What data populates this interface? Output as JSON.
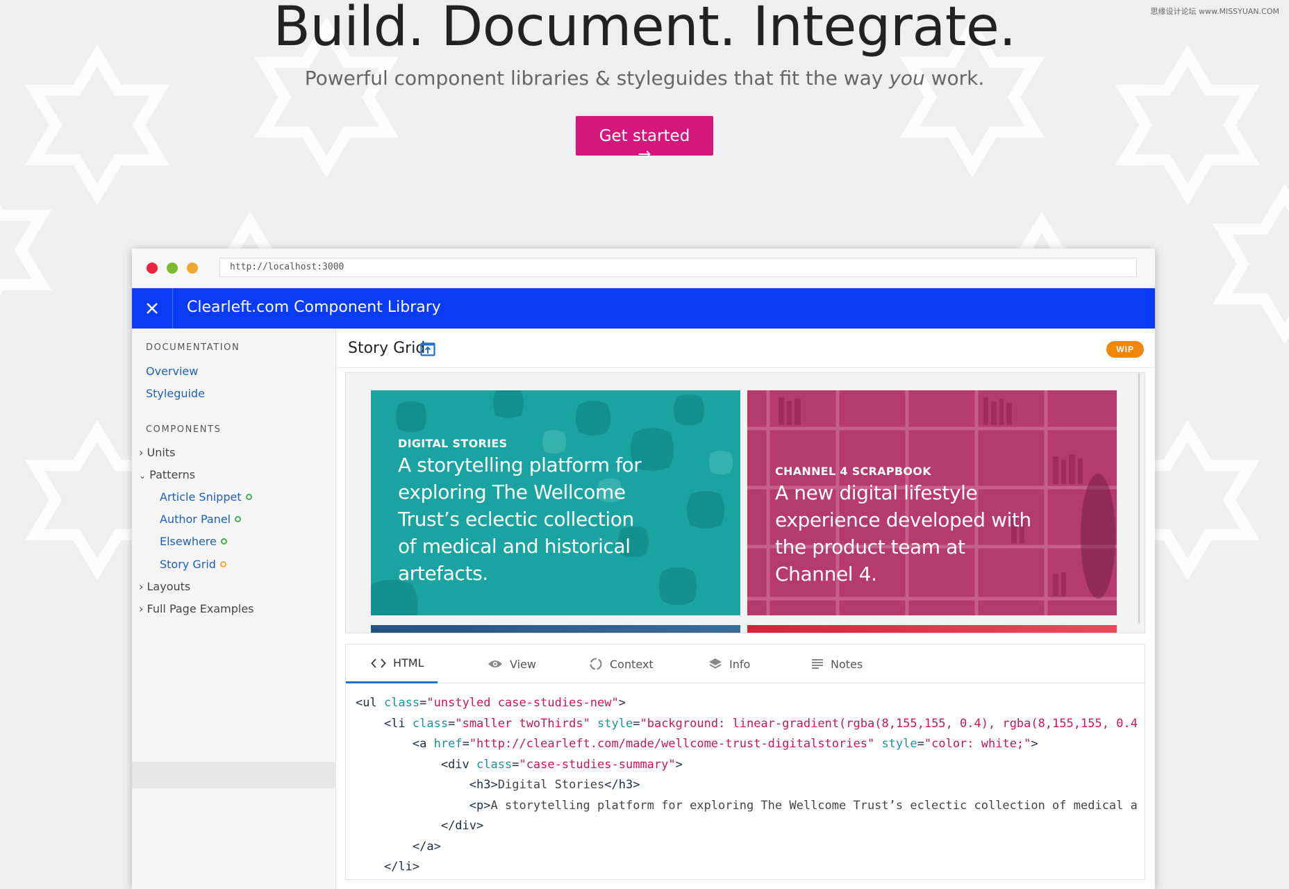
{
  "hero": {
    "title": "Build. Document. Integrate.",
    "subtitle_before": "Powerful component libraries & styleguides that fit the way ",
    "subtitle_em": "you",
    "subtitle_after": " work.",
    "cta_label": "Get started →"
  },
  "watermark": "思缘设计论坛 www.MISSYUAN.COM",
  "browser": {
    "url": "http://localhost:3000"
  },
  "app": {
    "title": "Clearleft.com Component Library"
  },
  "sidebar": {
    "documentation_heading": "DOCUMENTATION",
    "doc_links": [
      "Overview",
      "Styleguide"
    ],
    "components_heading": "COMPONENTS",
    "items": [
      {
        "label": "Units",
        "expanded": false
      },
      {
        "label": "Patterns",
        "expanded": true
      },
      {
        "label": "Layouts",
        "expanded": false
      },
      {
        "label": "Full Page Examples",
        "expanded": false
      }
    ],
    "pattern_children": [
      {
        "label": "Article Snippet",
        "status_color": "#3cb34a"
      },
      {
        "label": "Author Panel",
        "status_color": "#3cb34a"
      },
      {
        "label": "Elsewhere",
        "status_color": "#3cb34a"
      },
      {
        "label": "Story Grid",
        "status_color": "#f0a634",
        "active": true
      }
    ]
  },
  "component": {
    "name": "Story Grid",
    "status_badge": "WIP",
    "status_color": "#f0860a"
  },
  "preview": {
    "cards": [
      {
        "label": "DIGITAL STORIES",
        "body": "A storytelling platform for exploring The Wellcome Trust’s eclectic collection of medical and historical artefacts.",
        "color": "#1aa3a0"
      },
      {
        "label": "CHANNEL 4 SCRAPBOOK",
        "body": "A new digital lifestyle experience developed with the product team at Channel 4.",
        "color": "#b53a6e"
      }
    ]
  },
  "tabs": [
    {
      "label": "HTML",
      "icon": "code-icon",
      "active": true
    },
    {
      "label": "View",
      "icon": "eye-icon",
      "active": false
    },
    {
      "label": "Context",
      "icon": "refresh-icon",
      "active": false
    },
    {
      "label": "Info",
      "icon": "layers-icon",
      "active": false
    },
    {
      "label": "Notes",
      "icon": "notes-icon",
      "active": false
    }
  ],
  "code_lines": [
    "<ul class=\"unstyled case-studies-new\">",
    "    <li class=\"smaller twoThirds\" style=\"background: linear-gradient(rgba(8,155,155, 0.4), rgba(8,155,155, 0.4",
    "        <a href=\"http://clearleft.com/made/wellcome-trust-digitalstories\" style=\"color: white;\">",
    "            <div class=\"case-studies-summary\">",
    "                <h3>Digital Stories</h3>",
    "                <p>A storytelling platform for exploring The Wellcome Trust’s eclectic collection of medical a",
    "            </div>",
    "        </a>",
    "    </li>"
  ]
}
